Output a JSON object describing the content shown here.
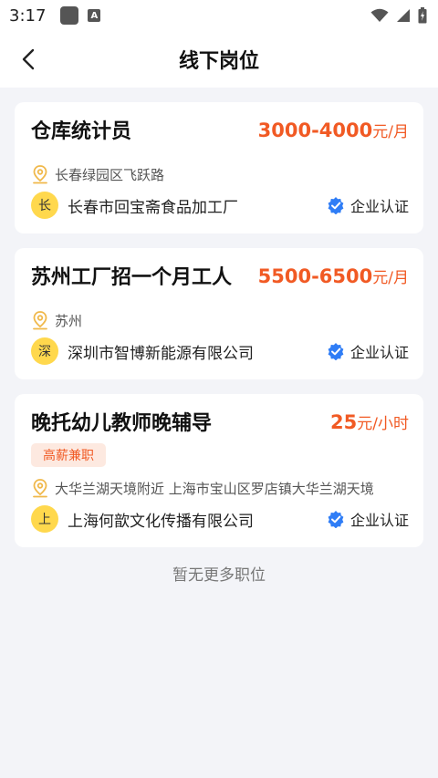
{
  "status_bar": {
    "time": "3:17"
  },
  "header": {
    "title": "线下岗位"
  },
  "jobs": [
    {
      "title": "仓库统计员",
      "salary": "3000-4000",
      "salary_unit": "元/月",
      "tag": "",
      "location": "长春绿园区飞跃路",
      "company_initial": "长",
      "company": "长春市回宝斋食品加工厂",
      "verified": "企业认证"
    },
    {
      "title": "苏州工厂招一个月工人",
      "salary": "5500-6500",
      "salary_unit": "元/月",
      "tag": "",
      "location": "苏州",
      "company_initial": "深",
      "company": "深圳市智博新能源有限公司",
      "verified": "企业认证"
    },
    {
      "title": "晚托幼儿教师晚辅导",
      "salary": "25",
      "salary_unit": "元/小时",
      "tag": "高薪兼职",
      "location": "大华兰湖天境附近 上海市宝山区罗店镇大华兰湖天境",
      "company_initial": "上",
      "company": "上海何歆文化传播有限公司",
      "verified": "企业认证"
    }
  ],
  "footer": {
    "end_text": "暂无更多职位"
  },
  "colors": {
    "accent": "#f15a24",
    "avatar": "#ffd84d",
    "verified": "#2f7df6",
    "location_icon": "#f0b84a"
  }
}
